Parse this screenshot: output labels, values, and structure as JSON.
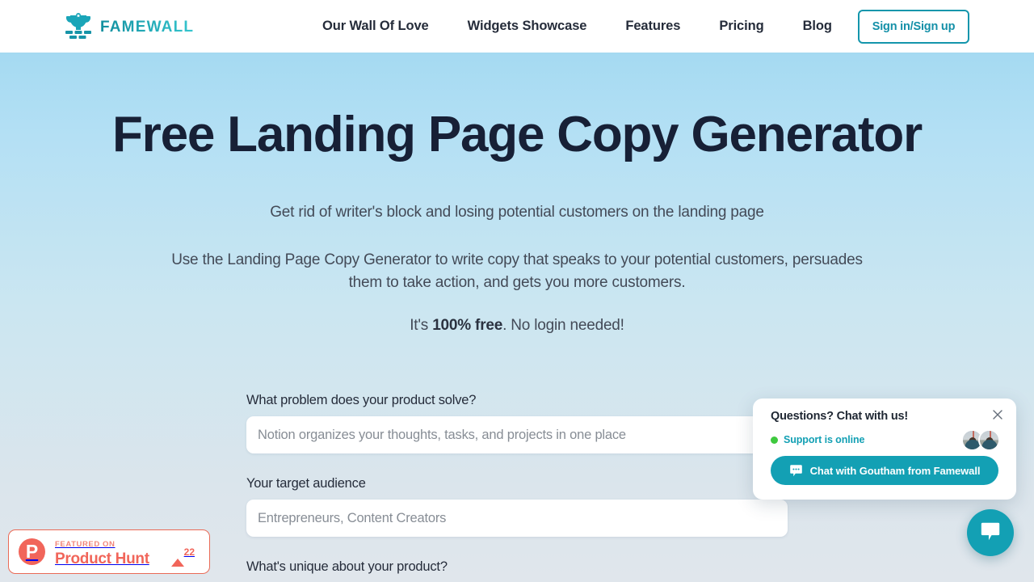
{
  "header": {
    "brand": "FAMEWALL",
    "nav": [
      {
        "label": "Our Wall Of Love"
      },
      {
        "label": "Widgets Showcase"
      },
      {
        "label": "Features"
      },
      {
        "label": "Pricing"
      },
      {
        "label": "Blog"
      }
    ],
    "signin_label": "Sign in/Sign up",
    "accent_color": "#1496ac"
  },
  "hero": {
    "title": "Free Landing Page Copy Generator",
    "subtitle_1": "Get rid of writer's block and losing potential customers on the landing page",
    "subtitle_2": "Use the Landing Page Copy Generator to write copy that speaks to your potential customers, persuades them to take action, and gets you more customers.",
    "free_prefix": "It's ",
    "free_strong": "100% free",
    "free_suffix": ". No login needed!",
    "bg_top_color": "#a5daf2",
    "bg_bottom_color": "#e0e6ec"
  },
  "form": {
    "fields": [
      {
        "label": "What problem does your product solve?",
        "placeholder": "Notion organizes your thoughts, tasks, and projects in one place",
        "value": ""
      },
      {
        "label": "Your target audience",
        "placeholder": "Entrepreneurs, Content Creators",
        "value": ""
      },
      {
        "label": "What's unique about your product?",
        "placeholder": "",
        "value": ""
      }
    ]
  },
  "product_hunt": {
    "logo_letter": "P",
    "featured_label": "FEATURED ON",
    "name": "Product Hunt",
    "upvotes": "22",
    "color": "#f1655a"
  },
  "chat": {
    "title": "Questions? Chat with us!",
    "status": "Support is online",
    "status_dot_color": "#3ec93e",
    "cta_label": "Chat with Goutham from Famewall",
    "accent_color": "#13a0b4"
  }
}
